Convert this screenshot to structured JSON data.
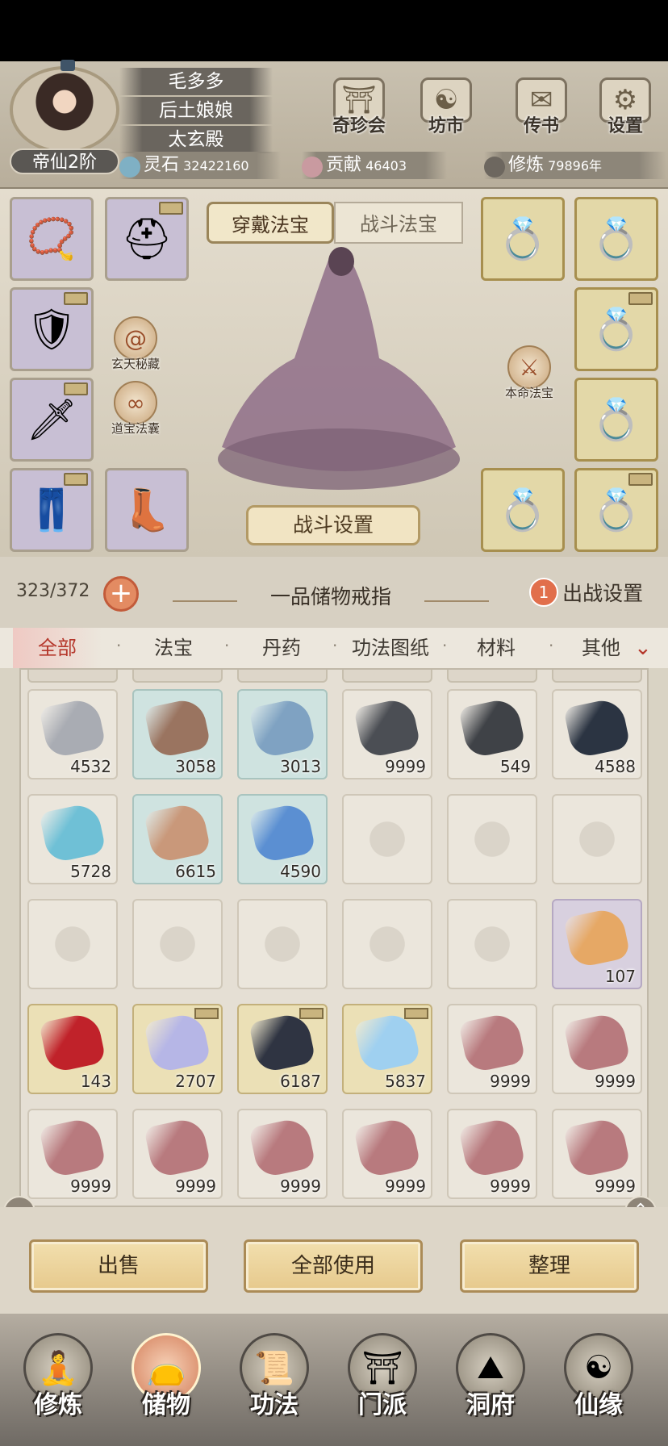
{
  "player": {
    "rank": "帝仙2阶",
    "names": [
      "毛多多",
      "后土娘娘",
      "太玄殿"
    ]
  },
  "top_buttons": [
    {
      "label": "奇珍会",
      "icon": "treasure-pavilion-icon"
    },
    {
      "label": "坊市",
      "icon": "market-icon"
    },
    {
      "label": "传书",
      "icon": "scroll-mail-icon"
    },
    {
      "label": "设置",
      "icon": "gear-icon"
    }
  ],
  "resources": {
    "spirit_stone": {
      "label": "灵石",
      "value": "32422160"
    },
    "contribution": {
      "label": "贡献",
      "value": "46403"
    },
    "cultivation": {
      "label": "修炼",
      "value": "79896年"
    }
  },
  "equip_tabs": {
    "worn": "穿戴法宝",
    "battle": "战斗法宝"
  },
  "side_buttons": {
    "xuantian": "玄天秘藏",
    "daobao": "道宝法囊",
    "benming": "本命法宝"
  },
  "battle_setup": "战斗设置",
  "bag": {
    "capacity": "323/372",
    "ring_name": "一品储物戒指",
    "sortie_badge": "1",
    "sortie_label": "出战设置"
  },
  "categories": [
    "全部",
    "法宝",
    "丹药",
    "功法图纸",
    "材料",
    "其他"
  ],
  "items": [
    {
      "qty": "4532",
      "color": "#a9acb3",
      "bg": "plain",
      "locked": false
    },
    {
      "qty": "3058",
      "color": "#9a7460",
      "bg": "teal",
      "locked": false
    },
    {
      "qty": "3013",
      "color": "#7fa2c2",
      "bg": "teal",
      "locked": false
    },
    {
      "qty": "9999",
      "color": "#4b4e54",
      "bg": "plain",
      "locked": false
    },
    {
      "qty": "549",
      "color": "#3f4247",
      "bg": "plain",
      "locked": false
    },
    {
      "qty": "4588",
      "color": "#2b3442",
      "bg": "plain",
      "locked": false
    },
    {
      "qty": "5728",
      "color": "#6fc0d6",
      "bg": "plain",
      "locked": false
    },
    {
      "qty": "6615",
      "color": "#c9987a",
      "bg": "teal",
      "locked": false
    },
    {
      "qty": "4590",
      "color": "#5b8fd2",
      "bg": "teal",
      "locked": false
    },
    {
      "qty": "",
      "color": "",
      "bg": "empty",
      "locked": false
    },
    {
      "qty": "",
      "color": "",
      "bg": "empty",
      "locked": false
    },
    {
      "qty": "",
      "color": "",
      "bg": "empty",
      "locked": false
    },
    {
      "qty": "",
      "color": "",
      "bg": "empty",
      "locked": false
    },
    {
      "qty": "",
      "color": "",
      "bg": "empty",
      "locked": false
    },
    {
      "qty": "",
      "color": "",
      "bg": "empty",
      "locked": false
    },
    {
      "qty": "",
      "color": "",
      "bg": "empty",
      "locked": false
    },
    {
      "qty": "",
      "color": "",
      "bg": "empty",
      "locked": false
    },
    {
      "qty": "107",
      "color": "#e6a865",
      "bg": "purple",
      "locked": false
    },
    {
      "qty": "143",
      "color": "#c0222a",
      "bg": "gold",
      "locked": false
    },
    {
      "qty": "2707",
      "color": "#b6b6e6",
      "bg": "gold",
      "locked": true
    },
    {
      "qty": "6187",
      "color": "#2f3442",
      "bg": "gold",
      "locked": true
    },
    {
      "qty": "5837",
      "color": "#9fd0f0",
      "bg": "gold",
      "locked": true
    },
    {
      "qty": "9999",
      "color": "#b87a7e",
      "bg": "plain",
      "locked": false
    },
    {
      "qty": "9999",
      "color": "#b87a7e",
      "bg": "plain",
      "locked": false
    },
    {
      "qty": "9999",
      "color": "#b87a7e",
      "bg": "plain",
      "locked": false
    },
    {
      "qty": "9999",
      "color": "#b87a7e",
      "bg": "plain",
      "locked": false
    },
    {
      "qty": "9999",
      "color": "#b87a7e",
      "bg": "plain",
      "locked": false
    },
    {
      "qty": "9999",
      "color": "#b87a7e",
      "bg": "plain",
      "locked": false
    },
    {
      "qty": "9999",
      "color": "#b87a7e",
      "bg": "plain",
      "locked": false
    },
    {
      "qty": "9999",
      "color": "#b87a7e",
      "bg": "plain",
      "locked": false
    }
  ],
  "actions": {
    "sell": "出售",
    "use_all": "全部使用",
    "sort": "整理"
  },
  "nav": [
    {
      "label": "修炼",
      "icon": "cultivate-icon"
    },
    {
      "label": "储物",
      "icon": "storage-bag-icon"
    },
    {
      "label": "功法",
      "icon": "scroll-icon"
    },
    {
      "label": "门派",
      "icon": "sect-gate-icon"
    },
    {
      "label": "洞府",
      "icon": "cave-mansion-icon"
    },
    {
      "label": "仙缘",
      "icon": "immortal-fate-icon"
    }
  ],
  "colors": {
    "accent": "#b5372b",
    "gold": "#e6c98c"
  }
}
